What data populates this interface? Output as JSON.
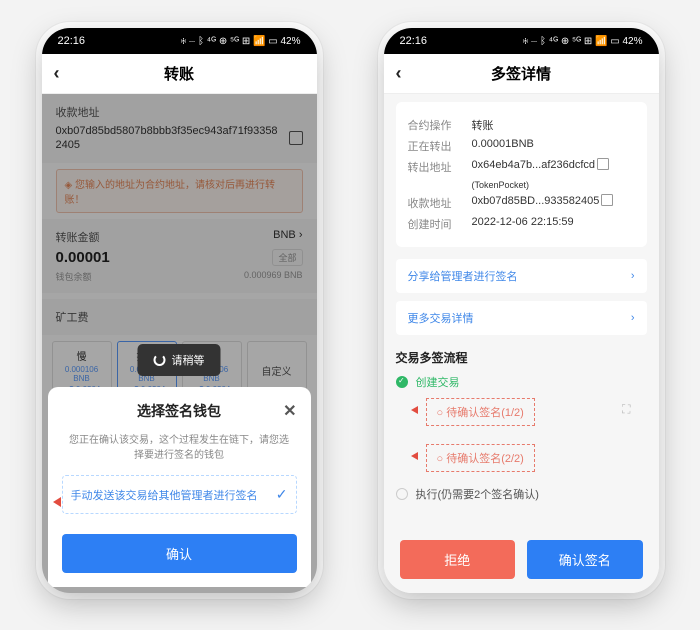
{
  "status": {
    "time": "22:16",
    "right": "✻ ⋯ ᛒ ⁴ᴳ ⊕ ⁵ᴳ ⊞ 📶 ▭ 42%"
  },
  "left": {
    "title": "转账",
    "addr_label": "收款地址",
    "addr": "0xb07d85bd5807b8bbb3f35ec943af71f933582405",
    "warning": "◈ 您输入的地址为合约地址，请核对后再进行转账！",
    "amount_label": "转账金额",
    "coin": "BNB",
    "amount": "0.00001",
    "all_btn": "全部",
    "balance_label": "钱包余额",
    "balance": "0.000969 BNB",
    "miner_label": "矿工费",
    "tabs": [
      {
        "t": "慢",
        "v1": "0.000106 BNB",
        "v2": "≈ $ 0.0304"
      },
      {
        "t": "推荐",
        "v1": "0.000106 BNB",
        "v2": "≈ $ 0.0304"
      },
      {
        "t": "快",
        "v1": "0.000106 BNB",
        "v2": "≈ $ 0.0304"
      }
    ],
    "custom": "自定义",
    "toast": "请稍等",
    "sheet_title": "选择签名钱包",
    "sheet_desc": "您正在确认该交易，这个过程发生在链下，请您选择要进行签名的钱包",
    "option": "手动发送该交易给其他管理者进行签名",
    "confirm": "确认"
  },
  "right": {
    "title": "多签详情",
    "rows": {
      "op_k": "合约操作",
      "op_v": "转账",
      "out_k": "正在转出",
      "out_v": "0.00001BNB",
      "outaddr_k": "转出地址",
      "outaddr_v": "0x64eb4a7b...af236dcfcd",
      "outaddr_sub": "(TokenPocket)",
      "inaddr_k": "收款地址",
      "inaddr_v": "0xb07d85BD...933582405",
      "time_k": "创建时间",
      "time_v": "2022-12-06 22:15:59"
    },
    "share": "分享给管理者进行签名",
    "more": "更多交易详情",
    "flow_title": "交易多签流程",
    "step_create": "创建交易",
    "sig1": "待确认签名(1/2)",
    "sig2": "待确认签名(2/2)",
    "step_exec": "执行(仍需要2个签名确认)",
    "reject": "拒绝",
    "sign": "确认签名"
  }
}
